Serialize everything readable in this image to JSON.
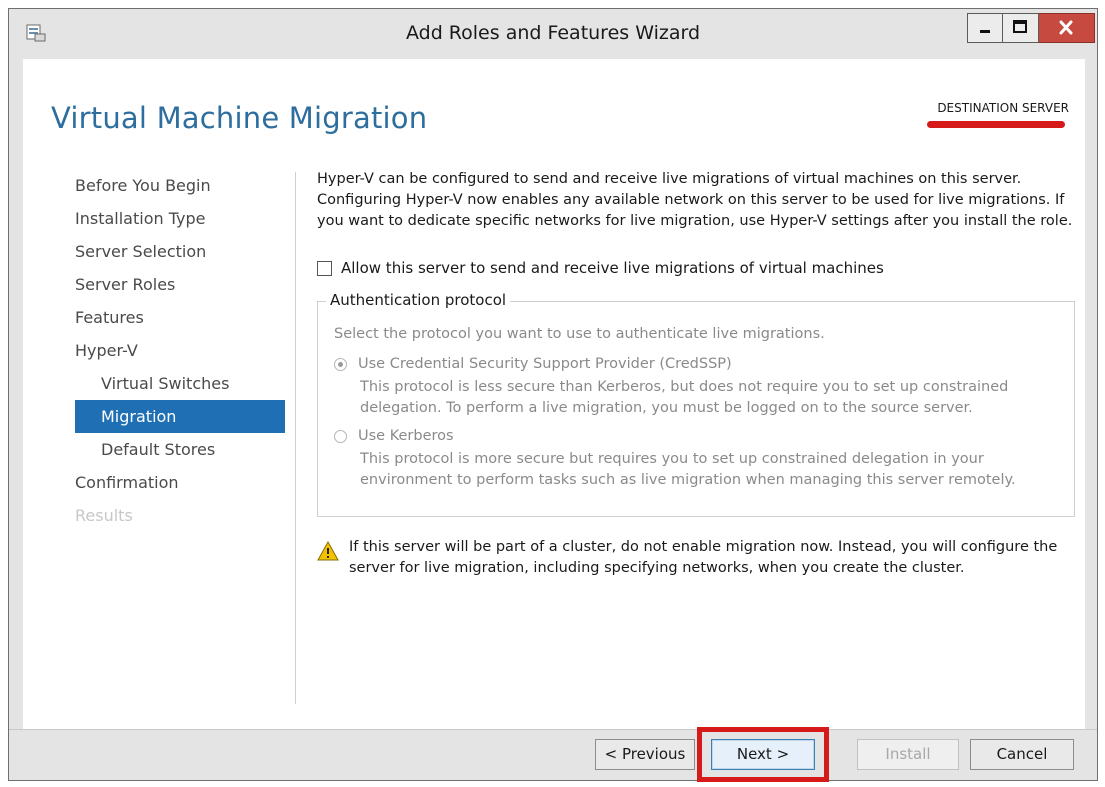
{
  "window": {
    "title": "Add Roles and Features Wizard",
    "controls": {
      "minimize": "minimize-icon",
      "maximize": "maximize-icon",
      "close": "close-icon"
    }
  },
  "header": {
    "page_title": "Virtual Machine Migration",
    "destination_label": "DESTINATION SERVER",
    "highlight_color": "#d61a1a"
  },
  "nav": {
    "items": [
      {
        "label": "Before You Begin"
      },
      {
        "label": "Installation Type"
      },
      {
        "label": "Server Selection"
      },
      {
        "label": "Server Roles"
      },
      {
        "label": "Features"
      },
      {
        "label": "Hyper-V"
      },
      {
        "label": "Virtual Switches"
      },
      {
        "label": "Migration"
      },
      {
        "label": "Default Stores"
      },
      {
        "label": "Confirmation"
      },
      {
        "label": "Results"
      }
    ],
    "selected_color": "#1f6fb5"
  },
  "content": {
    "intro_lines": [
      "Hyper-V can be configured to send and receive live migrations of virtual machines on this server.",
      "Configuring Hyper-V now enables any available network on this server to be used for live migrations. If",
      "you want to dedicate specific networks for live migration, use Hyper-V settings after you install the role."
    ],
    "allow_checkbox_label": "Allow this server to send and receive live migrations of virtual machines",
    "auth": {
      "legend": "Authentication protocol",
      "description": "Select the protocol you want to use to authenticate live migrations.",
      "credssp_label": "Use Credential Security Support Provider (CredSSP)",
      "credssp_desc": [
        "This protocol is less secure than Kerberos, but does not require you to set up constrained",
        "delegation. To perform a live migration, you must be logged on to the source server."
      ],
      "kerberos_label": "Use Kerberos",
      "kerberos_desc": [
        "This protocol is more secure but requires you to set up constrained delegation in your",
        "environment to perform tasks such as live migration when managing this server remotely."
      ]
    },
    "warning_lines": [
      "If this server will be part of a cluster, do not enable migration now. Instead, you will configure the",
      "server for live migration, including specifying networks, when you create the cluster."
    ]
  },
  "footer": {
    "previous": "< Previous",
    "next": "Next >",
    "install": "Install",
    "cancel": "Cancel"
  }
}
